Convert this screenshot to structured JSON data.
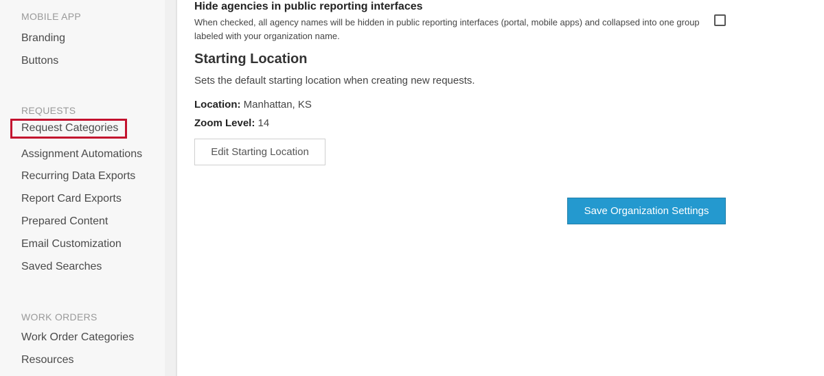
{
  "sidebar": {
    "sections": [
      {
        "heading": "MOBILE APP",
        "items": [
          "Branding",
          "Buttons"
        ]
      },
      {
        "heading": "REQUESTS",
        "items": [
          "Request Categories",
          "Assignment Automations",
          "Recurring Data Exports",
          "Report Card Exports",
          "Prepared Content",
          "Email Customization",
          "Saved Searches"
        ]
      },
      {
        "heading": "WORK ORDERS",
        "items": [
          "Work Order Categories",
          "Resources"
        ]
      }
    ],
    "highlighted_item": "Request Categories",
    "highlight_color": "#c3122e"
  },
  "main": {
    "hide_agencies": {
      "title": "Hide agencies in public reporting interfaces",
      "description": "When checked, all agency names will be hidden in public reporting interfaces (portal, mobile apps) and collapsed into one group labeled with your organization name.",
      "checked": false
    },
    "starting_location": {
      "heading": "Starting Location",
      "description": "Sets the default starting location when creating new requests.",
      "location_label": "Location:",
      "location_value": "Manhattan, KS",
      "zoom_label": "Zoom Level:",
      "zoom_value": "14",
      "edit_button": "Edit Starting Location"
    },
    "save_button": "Save Organization Settings",
    "accent_color": "#2499cf"
  }
}
